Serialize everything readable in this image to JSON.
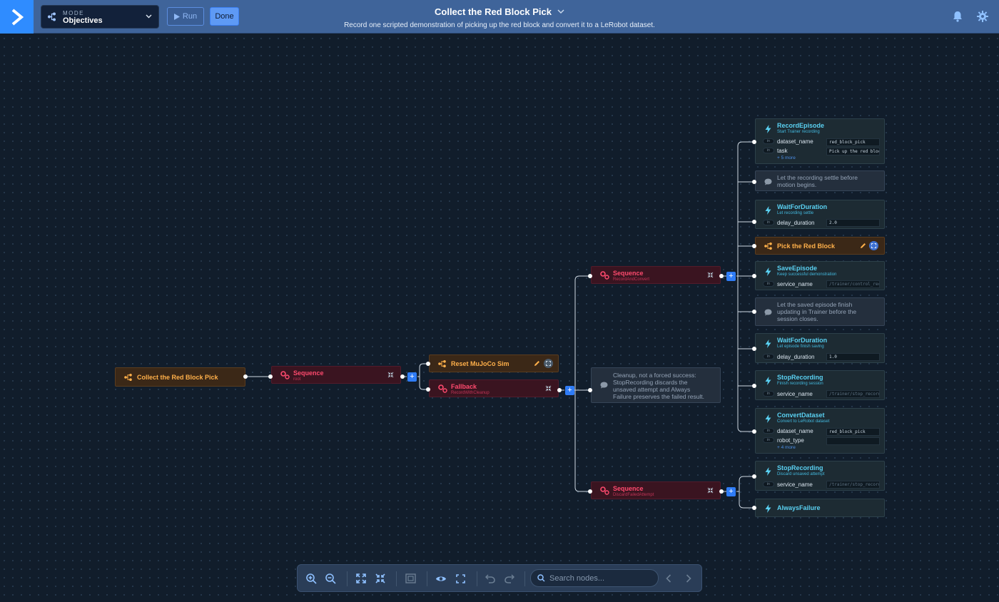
{
  "header": {
    "mode_label": "MODE",
    "mode_value": "Objectives",
    "run_label": "Run",
    "done_label": "Done",
    "title": "Collect the Red Block Pick",
    "subtitle": "Record one scripted demonstration of picking up the red block and convert it to a LeRobot dataset."
  },
  "tree": {
    "root": {
      "label": "Collect the Red Block Pick"
    },
    "seq_root": {
      "label": "Sequence",
      "sub": "root"
    },
    "reset": {
      "label": "Reset MuJoCo Sim"
    },
    "fallback": {
      "label": "Fallback",
      "sub": "RecordWithCleanup"
    },
    "seq_record": {
      "label": "Sequence",
      "sub": "RecordAndConvert"
    },
    "cleanup_comment": {
      "text": [
        "Cleanup, not a forced success:",
        "StopRecording discards the",
        "unsaved attempt and Always",
        "Failure preserves the failed result."
      ]
    },
    "seq_discard": {
      "label": "Sequence",
      "sub": "DiscardFailedAttempt"
    },
    "record_episode": {
      "label": "RecordEpisode",
      "sub": "Start Trainer recording",
      "ports": [
        {
          "name": "dataset_name",
          "value": "red_block_pick"
        },
        {
          "name": "task",
          "value": "Pick up the red block"
        }
      ],
      "more": "+ 5 more"
    },
    "comment_settle": {
      "text": [
        "Let the recording settle before",
        "motion begins."
      ]
    },
    "wait_1": {
      "label": "WaitForDuration",
      "sub": "Let recording settle",
      "ports": [
        {
          "name": "delay_duration",
          "value": "2.0"
        }
      ]
    },
    "pick": {
      "label": "Pick the Red Block"
    },
    "save_episode": {
      "label": "SaveEpisode",
      "sub": "Keep successful demonstration",
      "ports": [
        {
          "name": "service_name",
          "value": "/trainer/control_reco"
        }
      ]
    },
    "comment_saved": {
      "text": [
        "Let the saved episode finish",
        "updating in Trainer before the",
        "session closes."
      ]
    },
    "wait_2": {
      "label": "WaitForDuration",
      "sub": "Let episode finish saving",
      "ports": [
        {
          "name": "delay_duration",
          "value": "1.0"
        }
      ]
    },
    "stop_1": {
      "label": "StopRecording",
      "sub": "Finish recording session",
      "ports": [
        {
          "name": "service_name",
          "value": "/trainer/stop_recordi"
        }
      ]
    },
    "convert": {
      "label": "ConvertDataset",
      "sub": "Convert to LeRobot dataset",
      "ports": [
        {
          "name": "dataset_name",
          "value": "red_block_pick"
        },
        {
          "name": "robot_type",
          "value": ""
        }
      ],
      "more": "+ 4 more"
    },
    "stop_2": {
      "label": "StopRecording",
      "sub": "Discard unsaved attempt",
      "ports": [
        {
          "name": "service_name",
          "value": "/trainer/stop_recordi"
        }
      ]
    },
    "always_failure": {
      "label": "AlwaysFailure"
    },
    "port_tag": "in"
  },
  "toolbar": {
    "search_placeholder": "Search nodes..."
  },
  "colors": {
    "header_bg": "#3f649a",
    "accent": "#2f8cff",
    "subtree": "#ffb04a",
    "control": "#ff4a6e",
    "action": "#5ad1f2"
  }
}
